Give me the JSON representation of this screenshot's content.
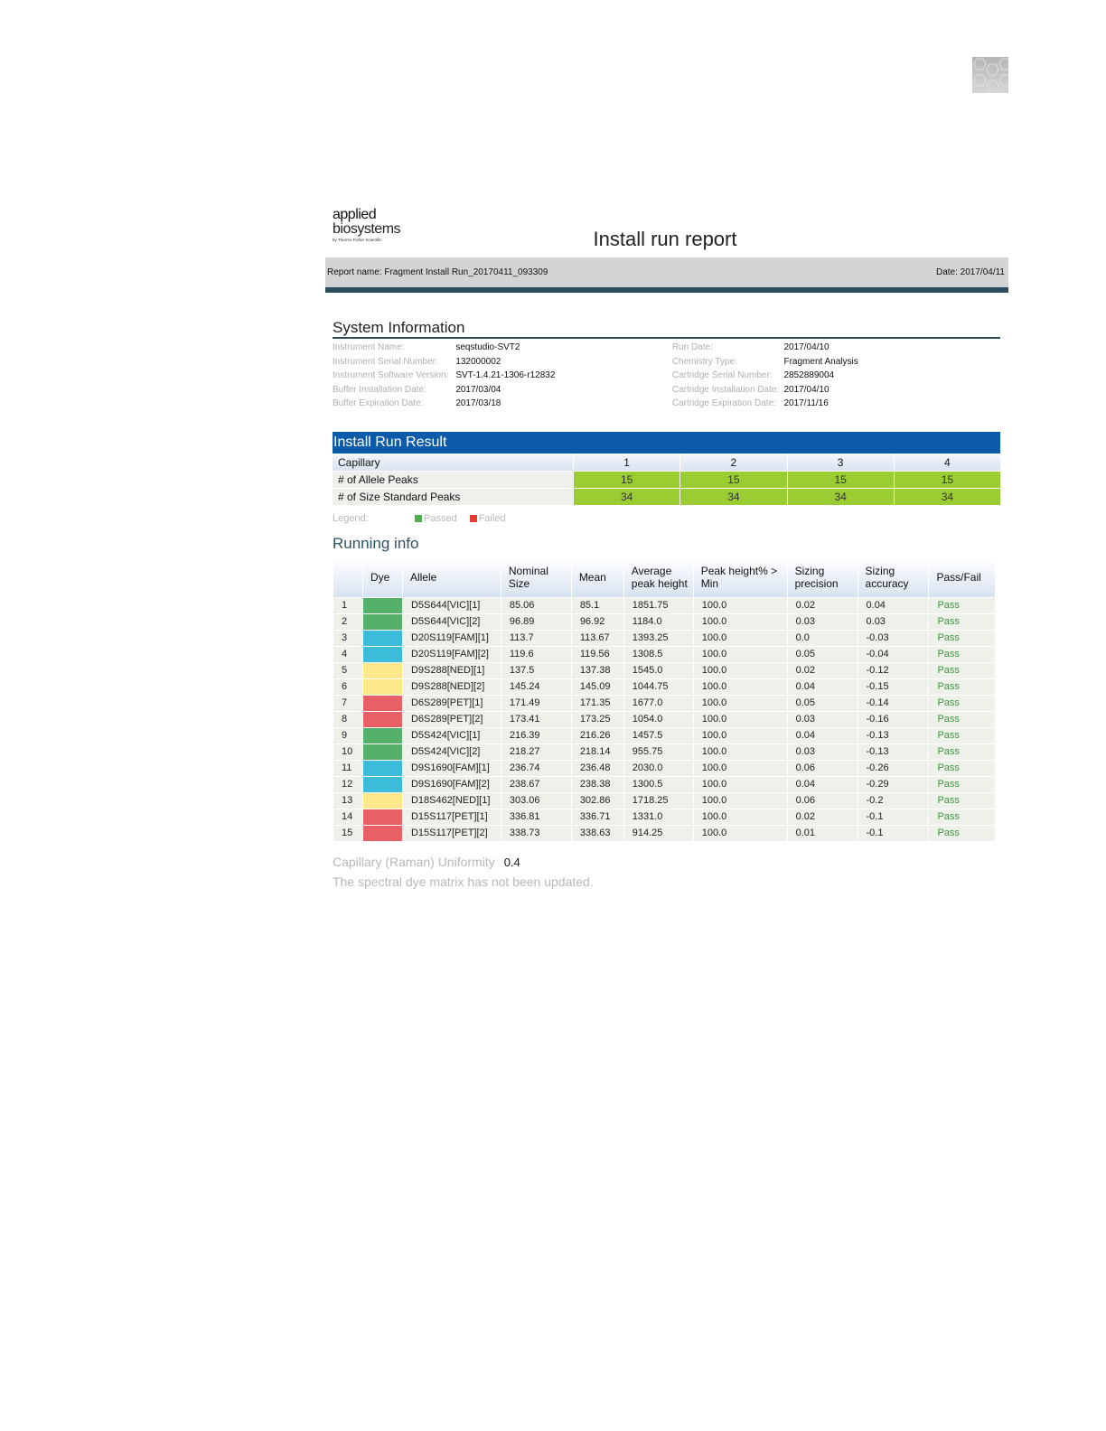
{
  "logo": {
    "line1": "applied",
    "line2": "biosystems",
    "line3": "by Thermo Fisher Scientific"
  },
  "title": "Install run report",
  "report_name": "Report name: Fragment Install Run_20170411_093309",
  "report_date": "Date: 2017/04/11",
  "system_info": {
    "heading": "System Information",
    "left": [
      {
        "k": "Instrument Name:",
        "v": "seqstudio-SVT2"
      },
      {
        "k": "Instrument Serial Number:",
        "v": "132000002"
      },
      {
        "k": "Instrument Software Version:",
        "v": "SVT-1.4.21-1306-r12832"
      },
      {
        "k": "Buffer Installation Date:",
        "v": "2017/03/04"
      },
      {
        "k": "Buffer Expiration Date:",
        "v": "2017/03/18"
      }
    ],
    "right": [
      {
        "k": "Run Date:",
        "v": "2017/04/10"
      },
      {
        "k": "Chemistry Type:",
        "v": "Fragment Analysis"
      },
      {
        "k": "Cartridge Serial Number:",
        "v": "2852889004"
      },
      {
        "k": "Cartridge Installation Date:",
        "v": "2017/04/10"
      },
      {
        "k": "Cartridge Expiration Date:",
        "v": "2017/11/16"
      }
    ]
  },
  "install_result": {
    "heading": "Install Run Result",
    "capillary_label": "Capillary",
    "capillaries": [
      "1",
      "2",
      "3",
      "4"
    ],
    "rows": [
      {
        "label": "# of Allele Peaks",
        "values": [
          "15",
          "15",
          "15",
          "15"
        ]
      },
      {
        "label": "# of Size Standard Peaks",
        "values": [
          "34",
          "34",
          "34",
          "34"
        ]
      }
    ]
  },
  "legend": {
    "label": "Legend:",
    "passed": "Passed",
    "failed": "Failed",
    "passed_color": "#4caf50",
    "failed_color": "#e53935"
  },
  "running_info": {
    "heading": "Running info",
    "columns": [
      "",
      "Dye",
      "Allele",
      "Nominal Size",
      "Mean",
      "Average peak height",
      "Peak height% > Min",
      "Sizing precision",
      "Sizing accuracy",
      "Pass/Fail"
    ],
    "dye_colors": {
      "VIC": "#55b06a",
      "FAM": "#3bbcd8",
      "NED": "#fde98a",
      "PET": "#e86065"
    },
    "rows": [
      [
        "1",
        "VIC",
        "D5S644[VIC][1]",
        "85.06",
        "85.1",
        "1851.75",
        "100.0",
        "0.02",
        "0.04",
        "Pass"
      ],
      [
        "2",
        "VIC",
        "D5S644[VIC][2]",
        "96.89",
        "96.92",
        "1184.0",
        "100.0",
        "0.03",
        "0.03",
        "Pass"
      ],
      [
        "3",
        "FAM",
        "D20S119[FAM][1]",
        "113.7",
        "113.67",
        "1393.25",
        "100.0",
        "0.0",
        "-0.03",
        "Pass"
      ],
      [
        "4",
        "FAM",
        "D20S119[FAM][2]",
        "119.6",
        "119.56",
        "1308.5",
        "100.0",
        "0.05",
        "-0.04",
        "Pass"
      ],
      [
        "5",
        "NED",
        "D9S288[NED][1]",
        "137.5",
        "137.38",
        "1545.0",
        "100.0",
        "0.02",
        "-0.12",
        "Pass"
      ],
      [
        "6",
        "NED",
        "D9S288[NED][2]",
        "145.24",
        "145.09",
        "1044.75",
        "100.0",
        "0.04",
        "-0.15",
        "Pass"
      ],
      [
        "7",
        "PET",
        "D6S289[PET][1]",
        "171.49",
        "171.35",
        "1677.0",
        "100.0",
        "0.05",
        "-0.14",
        "Pass"
      ],
      [
        "8",
        "PET",
        "D6S289[PET][2]",
        "173.41",
        "173.25",
        "1054.0",
        "100.0",
        "0.03",
        "-0.16",
        "Pass"
      ],
      [
        "9",
        "VIC",
        "D5S424[VIC][1]",
        "216.39",
        "216.26",
        "1457.5",
        "100.0",
        "0.04",
        "-0.13",
        "Pass"
      ],
      [
        "10",
        "VIC",
        "D5S424[VIC][2]",
        "218.27",
        "218.14",
        "955.75",
        "100.0",
        "0.03",
        "-0.13",
        "Pass"
      ],
      [
        "11",
        "FAM",
        "D9S1690[FAM][1]",
        "236.74",
        "236.48",
        "2030.0",
        "100.0",
        "0.06",
        "-0.26",
        "Pass"
      ],
      [
        "12",
        "FAM",
        "D9S1690[FAM][2]",
        "238.67",
        "238.38",
        "1300.5",
        "100.0",
        "0.04",
        "-0.29",
        "Pass"
      ],
      [
        "13",
        "NED",
        "D18S462[NED][1]",
        "303.06",
        "302.86",
        "1718.25",
        "100.0",
        "0.06",
        "-0.2",
        "Pass"
      ],
      [
        "14",
        "PET",
        "D15S117[PET][1]",
        "336.81",
        "336.71",
        "1331.0",
        "100.0",
        "0.02",
        "-0.1",
        "Pass"
      ],
      [
        "15",
        "PET",
        "D15S117[PET][2]",
        "338.73",
        "338.63",
        "914.25",
        "100.0",
        "0.01",
        "-0.1",
        "Pass"
      ]
    ]
  },
  "uniformity": {
    "label": "Capillary (Raman) Uniformity",
    "value": "0.4"
  },
  "matrix_note": "The spectral dye matrix has not been updated."
}
